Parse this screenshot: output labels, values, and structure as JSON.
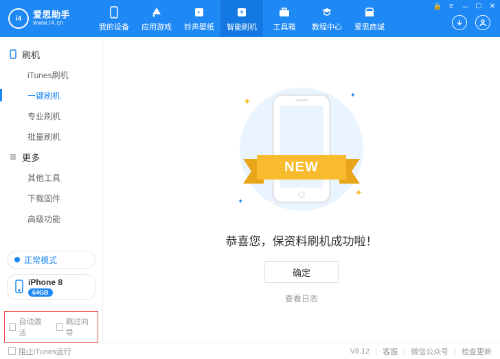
{
  "brand": {
    "logo_text": "i4",
    "cn": "爱思助手",
    "url": "www.i4.cn"
  },
  "tabs": {
    "devices": "我的设备",
    "games": "应用游戏",
    "ringtones": "铃声壁纸",
    "flash": "智能刷机",
    "toolbox": "工具箱",
    "tutorials": "教程中心",
    "store": "爱思商城"
  },
  "ribbon": "NEW",
  "sidebar": {
    "group1_title": "刷机",
    "group1": [
      {
        "label": "iTunes刷机"
      },
      {
        "label": "一键刷机"
      },
      {
        "label": "专业刷机"
      },
      {
        "label": "批量刷机"
      }
    ],
    "group2_title": "更多",
    "group2": [
      {
        "label": "其他工具"
      },
      {
        "label": "下载固件"
      },
      {
        "label": "高级功能"
      }
    ],
    "mode": "正常模式",
    "device": {
      "name": "iPhone 8",
      "storage": "64GB"
    },
    "checks": {
      "auto_activate": "自动激活",
      "skip_guide": "跳过向导"
    }
  },
  "main": {
    "headline": "恭喜您，保资料刷机成功啦！",
    "ok": "确定",
    "view_log": "查看日志"
  },
  "statusbar": {
    "block_itunes": "阻止iTunes运行",
    "version": "V8.12",
    "support": "客服",
    "wechat": "微信公众号",
    "check_update": "检查更新"
  }
}
